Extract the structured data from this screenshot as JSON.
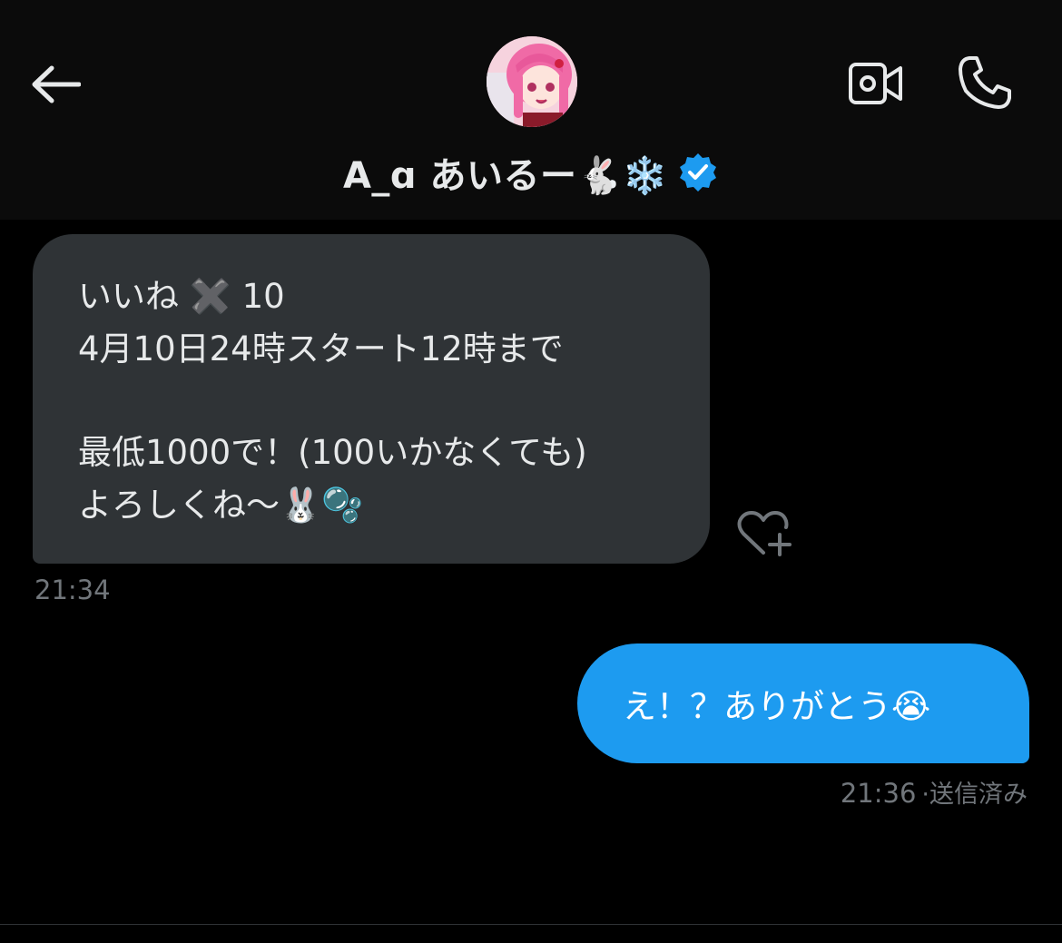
{
  "header": {
    "display_name": "A_ɑ あいるー🐇❄️",
    "icons": {
      "back": "arrow-left-icon",
      "video": "video-camera-icon",
      "phone": "phone-icon",
      "verified": "verified-badge-icon",
      "avatar": "profile-avatar"
    }
  },
  "messages": {
    "received": {
      "lines": [
        "いいね ✖️ 10",
        "4月10日24時スタート12時まで",
        "",
        "最低1000で！(100いかなくても)",
        "よろしくね〜🐰🫧"
      ],
      "time": "21:34",
      "reaction_icon": "heart-plus-icon"
    },
    "sent": {
      "text": "え！？ありがとう😭",
      "time": "21:36",
      "status": "·送信済み"
    }
  },
  "colors": {
    "background": "#000000",
    "header_background": "#0b0b0b",
    "incoming_bubble": "#2f3336",
    "outgoing_bubble": "#1d9bf0",
    "verified": "#1d9bf0",
    "muted_text": "#71767b",
    "primary_text": "#e7e9ea"
  }
}
